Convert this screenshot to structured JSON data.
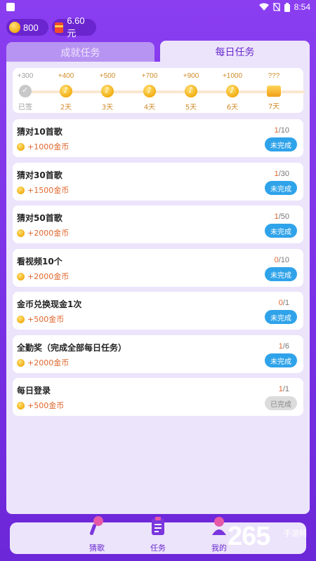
{
  "status_bar": {
    "time": "8:54"
  },
  "wallet": {
    "coins": "800",
    "cash": "6.60元"
  },
  "tabs": [
    {
      "label": "成就任务"
    },
    {
      "label": "每日任务"
    }
  ],
  "signin": {
    "days": [
      {
        "amount": "+300",
        "label": "已签",
        "state": "done"
      },
      {
        "amount": "+400",
        "label": "2天",
        "state": "coin"
      },
      {
        "amount": "+500",
        "label": "3天",
        "state": "coin"
      },
      {
        "amount": "+700",
        "label": "4天",
        "state": "coin"
      },
      {
        "amount": "+900",
        "label": "5天",
        "state": "coin"
      },
      {
        "amount": "+1000",
        "label": "6天",
        "state": "coin"
      },
      {
        "amount": "???",
        "label": "7天",
        "state": "chest"
      }
    ]
  },
  "tasks": [
    {
      "title": "猜对10首歌",
      "reward": "+1000金币",
      "current": "1",
      "total": "/10",
      "button": "未完成",
      "done": false
    },
    {
      "title": "猜对30首歌",
      "reward": "+1500金币",
      "current": "1",
      "total": "/30",
      "button": "未完成",
      "done": false
    },
    {
      "title": "猜对50首歌",
      "reward": "+2000金币",
      "current": "1",
      "total": "/50",
      "button": "未完成",
      "done": false
    },
    {
      "title": "看视频10个",
      "reward": "+2000金币",
      "current": "0",
      "total": "/10",
      "button": "未完成",
      "done": false
    },
    {
      "title": "金币兑换现金1次",
      "reward": "+500金币",
      "current": "0",
      "total": "/1",
      "button": "未完成",
      "done": false
    },
    {
      "title": "全勤奖（完成全部每日任务）",
      "reward": "+2000金币",
      "current": "1",
      "total": "/6",
      "button": "未完成",
      "done": false
    },
    {
      "title": "每日登录",
      "reward": "+500金币",
      "current": "1",
      "total": "/1",
      "button": "已完成",
      "done": true
    }
  ],
  "bottom_nav": [
    {
      "label": "猜歌",
      "icon": "microphone-icon"
    },
    {
      "label": "任务",
      "icon": "clipboard-icon"
    },
    {
      "label": "我的",
      "icon": "profile-icon"
    }
  ],
  "watermark": {
    "number": "265",
    "site": "手游网"
  },
  "colors": {
    "accent": "#6a2bd0",
    "button_blue": "#2fa3ea",
    "reward_orange": "#e0662c",
    "background": "#7a30e6"
  }
}
